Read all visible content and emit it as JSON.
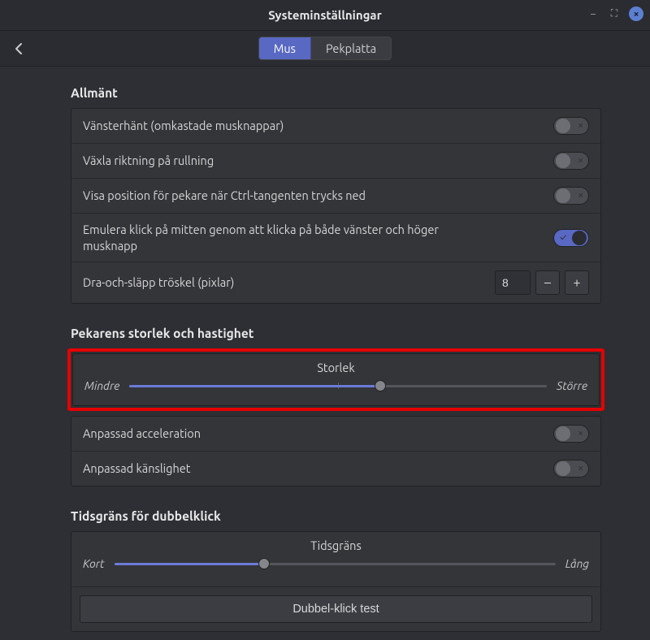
{
  "window": {
    "title": "Systeminställningar",
    "minimize": "–",
    "maximize": "⛶",
    "close": "×"
  },
  "header": {
    "back": "←",
    "tabs": {
      "mouse": "Mus",
      "touchpad": "Pekplatta"
    }
  },
  "sections": {
    "general": {
      "title": "Allmänt",
      "left_handed": "Vänsterhänt (omkastade musknappar)",
      "reverse_scroll": "Växla riktning på rullning",
      "show_pointer_ctrl": "Visa position för pekare när Ctrl-tangenten trycks ned",
      "emulate_middle": "Emulera klick på mitten genom att klicka på både vänster och höger musknapp",
      "drag_threshold_label": "Dra-och-släpp tröskel (pixlar)",
      "drag_threshold_value": "8",
      "minus": "–",
      "plus": "+"
    },
    "pointer": {
      "title": "Pekarens storlek och hastighet",
      "size_label": "Storlek",
      "smaller": "Mindre",
      "larger": "Större",
      "accel": "Anpassad acceleration",
      "sens": "Anpassad känslighet"
    },
    "dblclick": {
      "title": "Tidsgräns för dubbelklick",
      "timeout_label": "Tidsgräns",
      "short": "Kort",
      "long": "Lång",
      "test_button": "Dubbel-klick test"
    }
  },
  "state": {
    "toggles": {
      "left_handed": false,
      "reverse_scroll": false,
      "show_pointer_ctrl": false,
      "emulate_middle": true,
      "accel": false,
      "sens": false
    },
    "sliders": {
      "size_percent": 60,
      "dblclick_percent": 34
    }
  }
}
